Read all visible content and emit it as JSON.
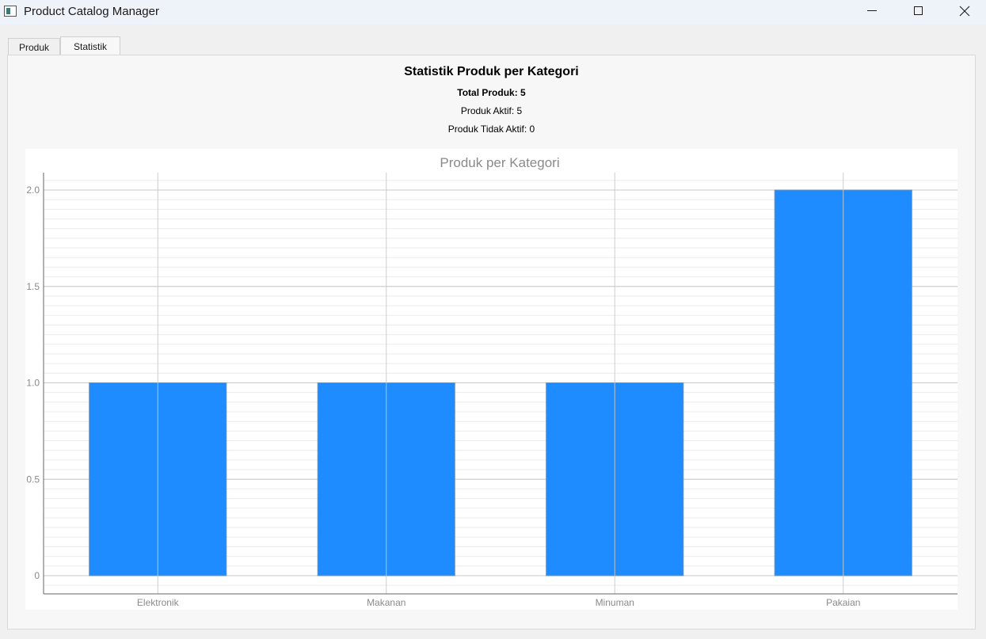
{
  "window": {
    "title": "Product Catalog Manager"
  },
  "tabs": [
    {
      "label": "Produk",
      "selected": false
    },
    {
      "label": "Statistik",
      "selected": true
    }
  ],
  "stats": {
    "heading": "Statistik Produk per Kategori",
    "total": "Total Produk: 5",
    "aktif": "Produk Aktif: 5",
    "tidak_aktif": "Produk Tidak Aktif: 0"
  },
  "colors": {
    "bar": "#1e8cff",
    "grid_major": "#c8c8c8",
    "grid_minor": "#ebebeb",
    "axis_text": "#8a8a8a"
  },
  "chart_data": {
    "type": "bar",
    "title": "Produk per Kategori",
    "categories": [
      "Elektronik",
      "Makanan",
      "Minuman",
      "Pakaian"
    ],
    "values": [
      1,
      1,
      1,
      2
    ],
    "ylim": [
      0,
      2.1
    ],
    "yticks": [
      "0",
      "0.5",
      "1.0",
      "1.5",
      "2.0"
    ],
    "ytick_values": [
      0,
      0.5,
      1.0,
      1.5,
      2.0
    ],
    "xlabel": "",
    "ylabel": "",
    "grid": true
  }
}
